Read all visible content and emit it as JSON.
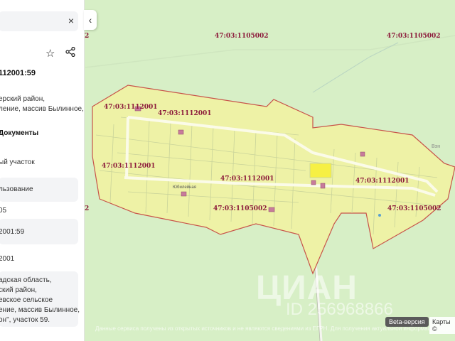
{
  "panel": {
    "close_icon": "×",
    "cadastral_number": "112001:59",
    "address_lines": [
      "ерский район,",
      "ление, массив Былинное,"
    ],
    "documents_label": "Документы",
    "type_value": "ый участок",
    "usage_value": "льзование",
    "number_fragment": "05",
    "quarter_number": "2001:59",
    "code_fragment": "2001",
    "full_address": [
      "адская область,",
      "ский район,",
      "евское сельское",
      "ение, массив Былинное,",
      "он\", участок 59."
    ]
  },
  "map": {
    "labels": [
      "47:03:1105002",
      "47:03:1105002",
      "47:03:1112001",
      "47:03:1112001",
      "47:03:1112001",
      "47:03:1112001",
      "47:03:1112001",
      "47:03:1105002",
      "47:03:1105002"
    ],
    "left_edge_marks": [
      "2",
      "2"
    ],
    "place_label": "Юбилейная",
    "right_place": "Вэн",
    "beta_badge": "Beta-версия",
    "maps_credit": "Карты ©",
    "watermark_logo": "ЦИАН",
    "watermark_id": "ID 256968866",
    "footer_notice": "Данные сервиса получены из открытых источников и не являются сведениями из ЕГРН. Для получения актуальной информации обратитесь к первоисточнику."
  },
  "colors": {
    "map_background": "#d7efc6",
    "parcel_fill": "#eef2a6",
    "parcel_border": "#c8534a",
    "label_color": "#8c1b3b",
    "highlight_plot": "#f6f044"
  },
  "icons": [
    "close-icon",
    "chevron-left-icon",
    "star-icon",
    "share-icon"
  ]
}
